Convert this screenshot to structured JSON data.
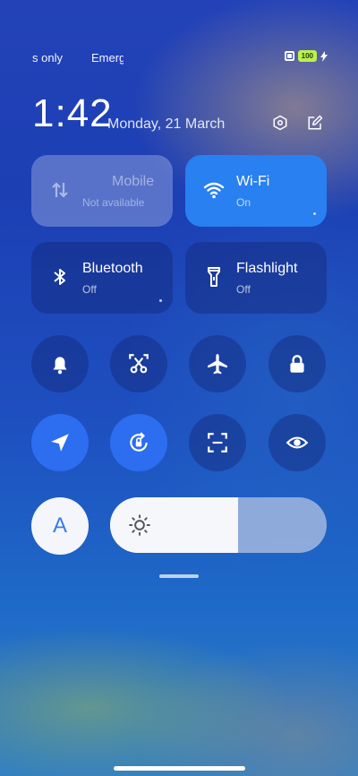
{
  "status_bar": {
    "left_text": "s only",
    "mid_text": "Emerg",
    "battery_level": "100",
    "icons": [
      "nfc-icon",
      "battery-icon",
      "charging-icon"
    ]
  },
  "header": {
    "time": "1:42",
    "date": "Monday, 21 March",
    "buttons": [
      "settings-icon",
      "edit-icon"
    ]
  },
  "tiles": {
    "mobile": {
      "title": "Mobile",
      "status": "Not available",
      "state": "disabled"
    },
    "wifi": {
      "title": "Wi-Fi",
      "status": "On",
      "state": "on"
    },
    "bluetooth": {
      "title": "Bluetooth",
      "status": "Off",
      "state": "off"
    },
    "flashlight": {
      "title": "Flashlight",
      "status": "Off",
      "state": "off"
    }
  },
  "toggles_row1": [
    {
      "icon": "bell-icon",
      "active": false
    },
    {
      "icon": "scissors-screenshot-icon",
      "active": false
    },
    {
      "icon": "airplane-icon",
      "active": false
    },
    {
      "icon": "lock-icon",
      "active": false
    }
  ],
  "toggles_row2": [
    {
      "icon": "location-icon",
      "active": true
    },
    {
      "icon": "rotation-lock-icon",
      "active": true
    },
    {
      "icon": "scan-icon",
      "active": false
    },
    {
      "icon": "eye-icon",
      "active": false
    }
  ],
  "auto_brightness": {
    "label": "A"
  },
  "brightness": {
    "level_percent": 59
  },
  "colors": {
    "accent": "#2d6df0",
    "wifi_active": "#2980f0",
    "battery": "#b9f24b"
  }
}
